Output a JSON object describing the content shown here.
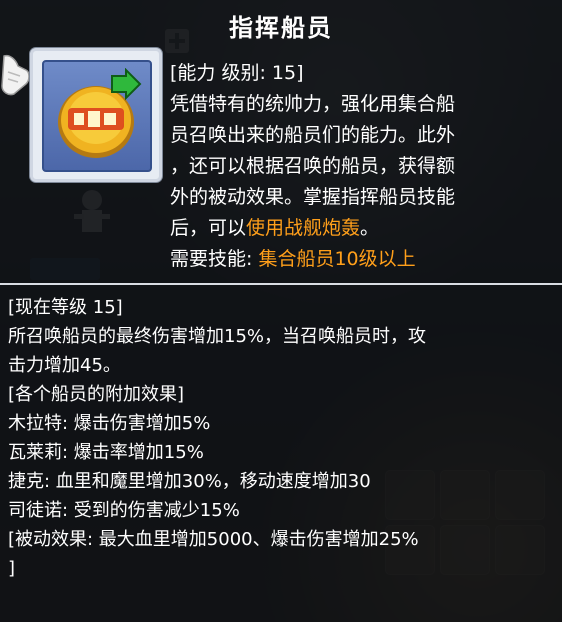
{
  "tooltip": {
    "title": "指挥船员",
    "icon_name": "commander-crew-skill-icon",
    "description_lines": [
      {
        "parts": [
          {
            "text": "[能力  级别: 15]"
          }
        ]
      },
      {
        "parts": [
          {
            "text": "凭借特有的统帅力，强化用集合船"
          }
        ]
      },
      {
        "parts": [
          {
            "text": "员召唤出来的船员们的能力。此外"
          }
        ]
      },
      {
        "parts": [
          {
            "text": "，还可以根据召唤的船员，获得额"
          }
        ]
      },
      {
        "parts": [
          {
            "text": "外的被动效果。掌握指挥船员技能"
          }
        ]
      },
      {
        "parts": [
          {
            "text": "后，可以"
          },
          {
            "text": "使用战舰炮轰",
            "highlight": true
          },
          {
            "text": "。"
          }
        ]
      },
      {
        "parts": [
          {
            "text": "需要技能: "
          },
          {
            "text": "集合船员10级以上",
            "highlight": true
          }
        ]
      }
    ],
    "effect_lines": [
      "[现在等级 15]",
      "所召唤船员的最终伤害增加15%，当召唤船员时，攻",
      "击力增加45。",
      "[各个船员的附加效果]",
      "木拉特: 爆击伤害增加5%",
      "瓦莱莉: 爆击率增加15%",
      "捷克: 血里和魔里增加30%，移动速度增加30",
      "司徒诺: 受到的伤害减少15%",
      "[被动效果: 最大血里增加5000、爆击伤害增加25%",
      "]"
    ],
    "colors": {
      "text": "#ffffff",
      "highlight": "#ff9f1a",
      "background": "#0c0e11"
    }
  }
}
